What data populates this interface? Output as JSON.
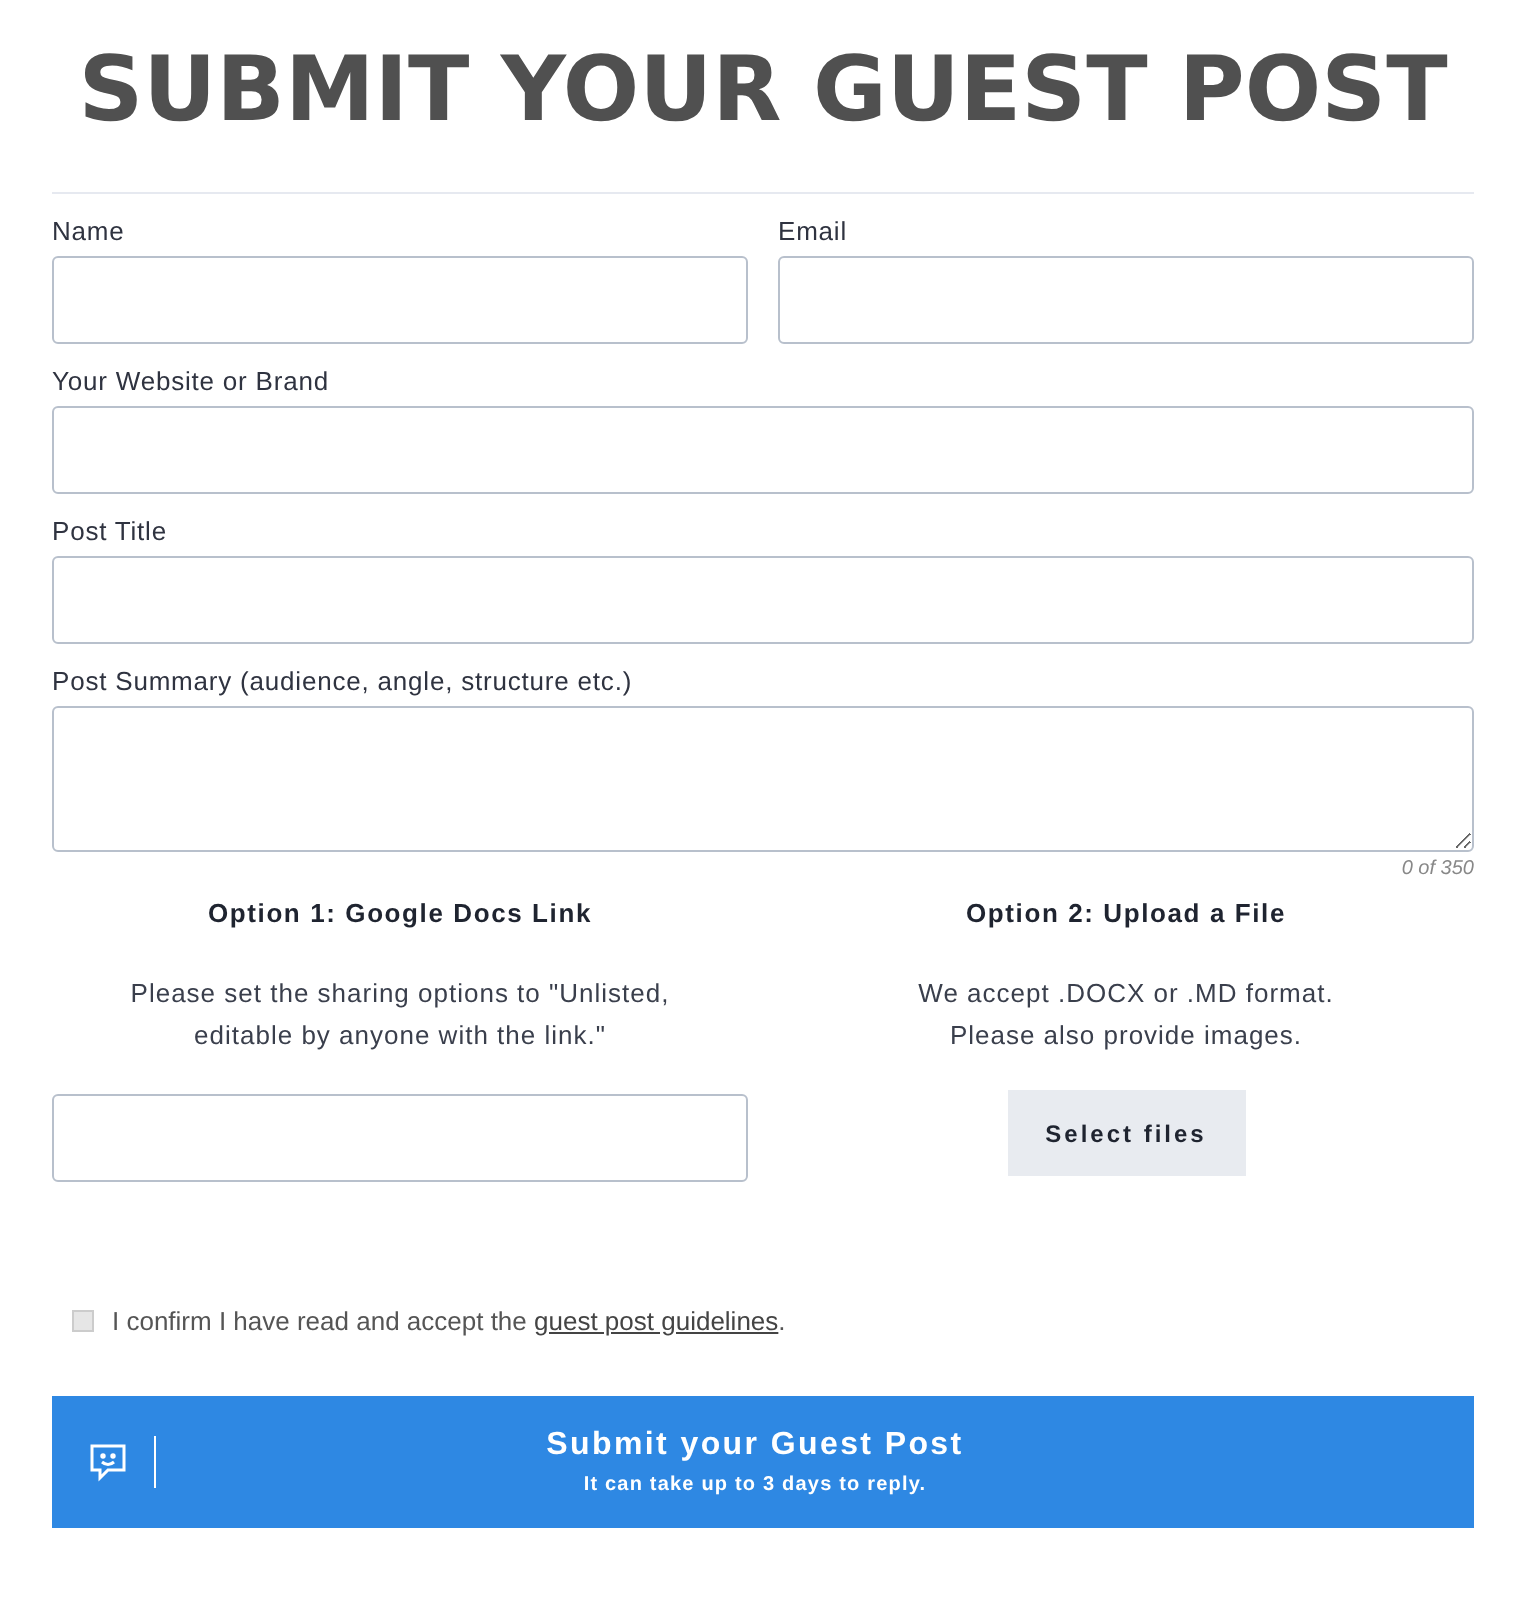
{
  "title": "SUBMIT YOUR GUEST POST",
  "fields": [
    {
      "label": "Name",
      "kind": "half"
    },
    {
      "label": "Email",
      "kind": "half"
    },
    {
      "label": "Your Website or Brand",
      "kind": "full"
    },
    {
      "label": "Post Title",
      "kind": "full"
    },
    {
      "label": "Post Summary (audience, angle, structure etc.)",
      "kind": "textarea",
      "counter": "0 of 350"
    }
  ],
  "options": [
    {
      "heading": "Option 1: Google Docs Link",
      "lines": [
        "Please set the sharing options to \"Unlisted,",
        "editable by anyone with the link.\""
      ],
      "kind": "link-field"
    },
    {
      "heading": "Option 2: Upload a File",
      "lines": [
        "We accept .DOCX or .MD format.",
        "Please also provide images."
      ],
      "kind": "upload",
      "button": "Select files"
    }
  ],
  "confirm": {
    "checked": false,
    "before": "I confirm I have read and accept the ",
    "link": "guest post guidelines",
    "after": "."
  },
  "submit": {
    "label": "Submit your Guest Post",
    "note": "It can take up to 3 days to reply."
  }
}
